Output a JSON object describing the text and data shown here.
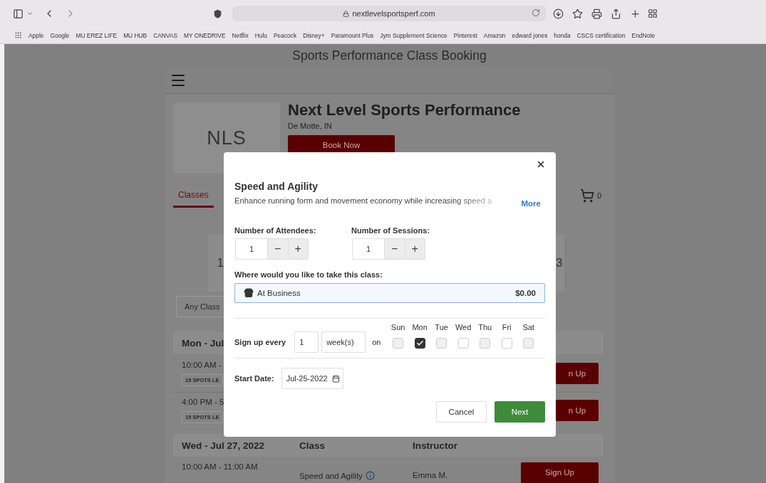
{
  "browser": {
    "url": "nextlevelsportsperf.com",
    "bookmarks": [
      "Apple",
      "Google",
      "MU EREZ LIFE",
      "MU HUB",
      "CANVAS",
      "MY ONEDRIVE",
      "Netflix",
      "Hulu",
      "Peacock",
      "Disney+",
      "Paramount Plus",
      "Jym Supplement Science",
      "Pinterest",
      "Amazon",
      "edward jones",
      "honda",
      "CSCS certification",
      "EndNote"
    ]
  },
  "page": {
    "title": "Sports Performance Class Booking",
    "business": {
      "logo_text": "NLS",
      "name": "Next Level Sports Performance",
      "location": "De Motte, IN",
      "book_button": "Book Now"
    },
    "tabs": [
      {
        "label": "Classes",
        "selected": true
      }
    ],
    "cart_count": "0",
    "date_cards": [
      {
        "text": "1"
      },
      {
        "text": "3"
      }
    ],
    "class_filter": "Any Class",
    "sections": [
      {
        "heading": "Mon - Jul",
        "rows": [
          {
            "time": "10:00 AM -",
            "badge": "15 SPOTS LE",
            "button": "n Up"
          },
          {
            "time": "4:00 PM - 5",
            "badge": "15 SPOTS LE",
            "button": "n Up"
          }
        ]
      },
      {
        "heading": "Wed - Jul 27, 2022",
        "columns": [
          "Class",
          "Instructor"
        ],
        "rows": [
          {
            "time": "10:00 AM - 11:00 AM",
            "class": "Speed and Agility",
            "instructor": "Emma M.",
            "button": "Sign Up"
          }
        ]
      }
    ]
  },
  "modal": {
    "title": "Speed and Agility",
    "description": "Enhance running form and movement economy while increasing speed a",
    "more": "More",
    "steppers": [
      {
        "label": "Number of Attendees:",
        "value": "1",
        "minus": "−",
        "plus": "+"
      },
      {
        "label": "Number of Sessions:",
        "value": "1",
        "minus": "−",
        "plus": "+"
      }
    ],
    "location_label": "Where would you like to take this class:",
    "locations": [
      {
        "label": "At Business",
        "price": "$0.00",
        "selected": true
      }
    ],
    "recurrence": {
      "label": "Sign up every",
      "interval": "1",
      "unit": "week(s)",
      "on": "on",
      "days": [
        {
          "label": "Sun",
          "checked": false,
          "disabled": true
        },
        {
          "label": "Mon",
          "checked": true,
          "disabled": false
        },
        {
          "label": "Tue",
          "checked": false,
          "disabled": true
        },
        {
          "label": "Wed",
          "checked": false,
          "disabled": false
        },
        {
          "label": "Thu",
          "checked": false,
          "disabled": true
        },
        {
          "label": "Fri",
          "checked": false,
          "disabled": false
        },
        {
          "label": "Sat",
          "checked": false,
          "disabled": true
        }
      ]
    },
    "start_date": {
      "label": "Start Date:",
      "value": "Jul-25-2022"
    },
    "buttons": [
      {
        "label": "Cancel",
        "kind": "secondary"
      },
      {
        "label": "Next",
        "kind": "primary"
      }
    ]
  }
}
